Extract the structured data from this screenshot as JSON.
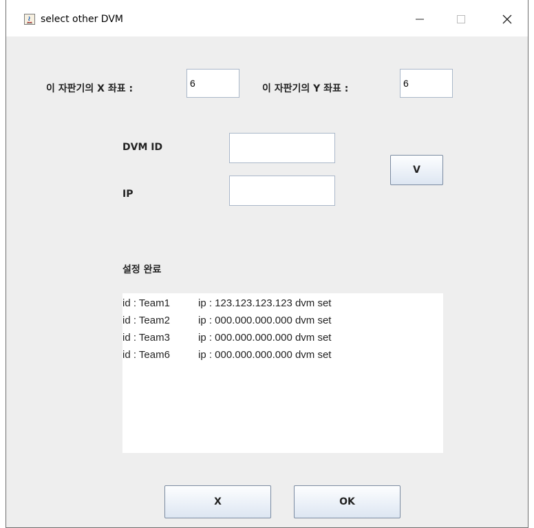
{
  "window": {
    "title": "select other DVM",
    "icon": "java-icon",
    "controls": {
      "minimize": "—",
      "maximize": "☐",
      "close": "✕"
    }
  },
  "coords": {
    "x_label": "이 자판기의 X 좌표 :",
    "x_value": "6",
    "y_label": "이 자판기의 Y 좌표 :",
    "y_value": "6"
  },
  "form": {
    "dvm_id_label": "DVM ID",
    "dvm_id_value": "",
    "ip_label": "IP",
    "ip_value": "",
    "confirm_label": "V"
  },
  "result": {
    "title": "설정 완료",
    "lines": [
      {
        "id": "id : Team1",
        "ip": "ip : 123.123.123.123 dvm set"
      },
      {
        "id": "id : Team2",
        "ip": "ip : 000.000.000.000 dvm set"
      },
      {
        "id": "id : Team3",
        "ip": "ip : 000.000.000.000 dvm set"
      },
      {
        "id": "id : Team6",
        "ip": "ip : 000.000.000.000 dvm set"
      }
    ]
  },
  "footer": {
    "cancel_label": "X",
    "ok_label": "OK"
  },
  "colors": {
    "background": "#eeeeee",
    "field_border": "#a9b7c9",
    "button_top": "#fdfeff",
    "button_bottom": "#dde6f2"
  }
}
